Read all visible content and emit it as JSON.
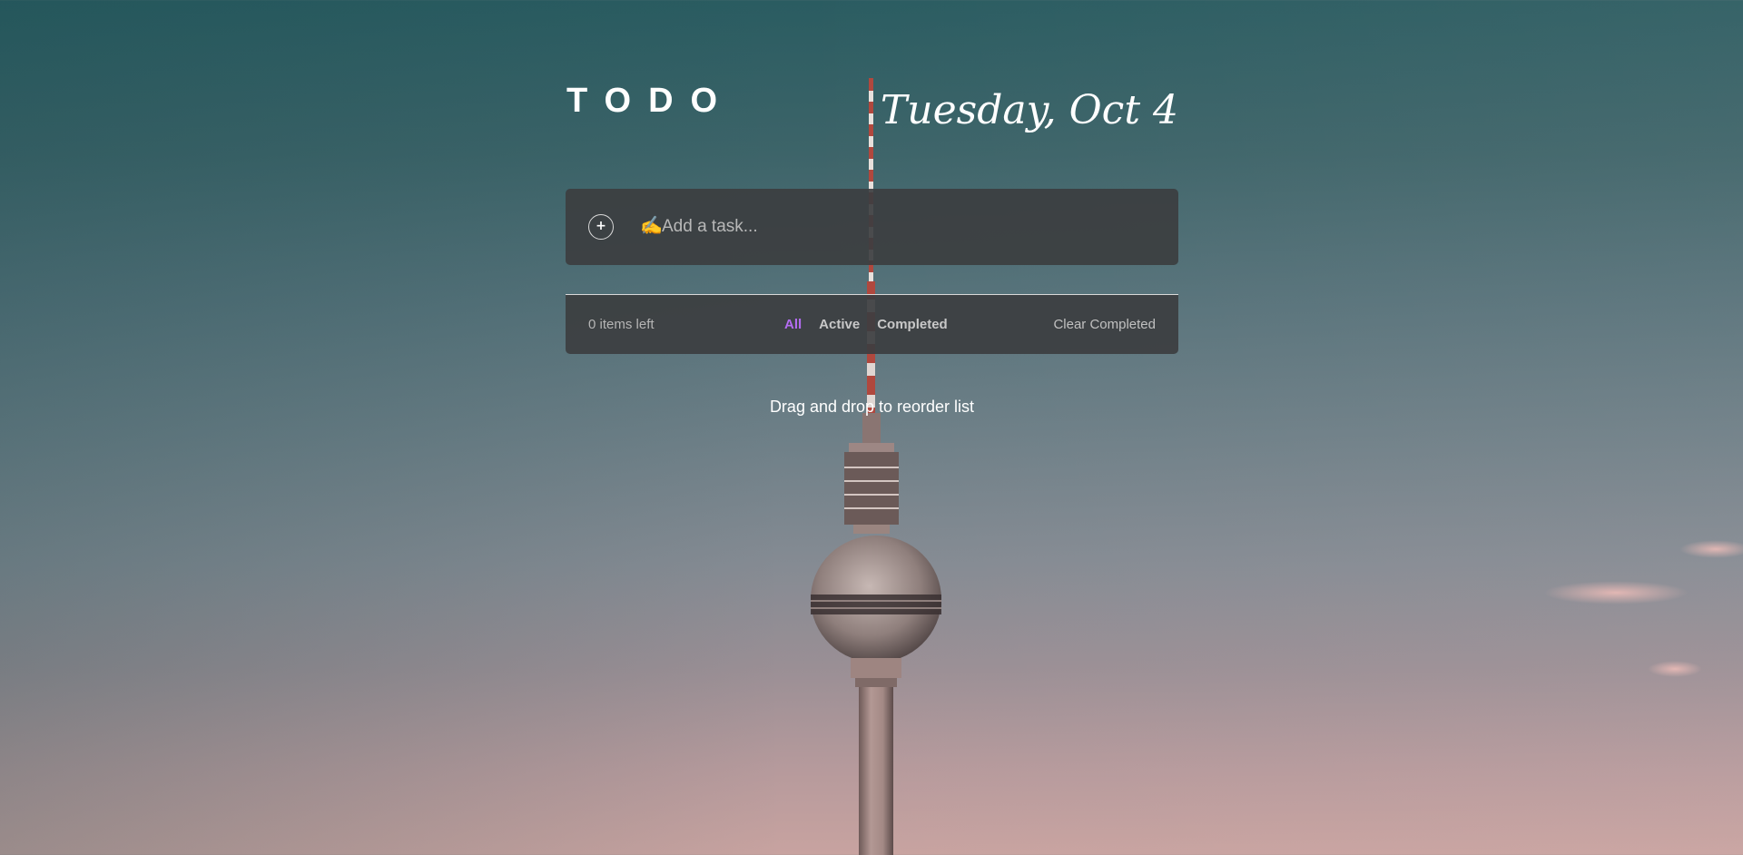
{
  "header": {
    "title": "TODO",
    "date": "Tuesday, Oct 4"
  },
  "add_task": {
    "add_icon_glyph": "+",
    "pen_icon_glyph": "✍️",
    "placeholder": "Add a task..."
  },
  "footer": {
    "items_left": "0 items left",
    "filters": [
      {
        "label": "All",
        "active": true
      },
      {
        "label": "Active",
        "active": false
      },
      {
        "label": "Completed",
        "active": false
      }
    ],
    "clear_label": "Clear Completed"
  },
  "hint": "Drag and drop to reorder list",
  "colors": {
    "active_filter": "#b36cf0",
    "panel": "#3c3e40",
    "text": "#ffffff"
  },
  "icons": [
    "add-icon",
    "pen-icon"
  ]
}
